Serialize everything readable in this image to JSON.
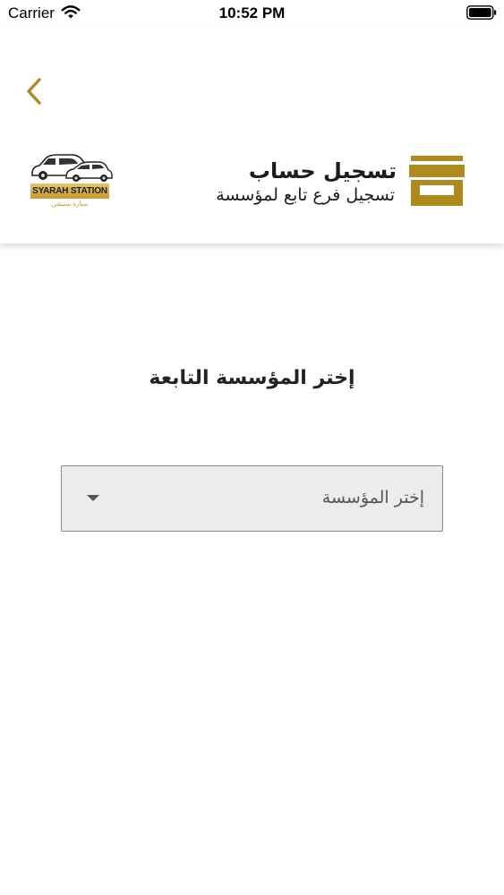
{
  "status_bar": {
    "carrier": "Carrier",
    "time": "10:52 PM",
    "icons": [
      "wifi-icon",
      "battery-icon"
    ]
  },
  "header": {
    "back_icon": "chevron-left-icon",
    "logo": {
      "brand": "SYARAH STATION",
      "brand_arabic": "سيارة ستيشن"
    },
    "title": "تسجيل حساب",
    "subtitle": "تسجيل فرع تابع لمؤسسة",
    "icon": "store-icon"
  },
  "form": {
    "label": "إختر المؤسسة التابعة",
    "select": {
      "selected": "إختر المؤسسة",
      "icon": "dropdown-arrow-icon"
    }
  },
  "colors": {
    "accent": "#b08a1e",
    "accent_light": "#d8ad45",
    "select_bg": "#ececef",
    "select_border": "#8a8a8e"
  }
}
